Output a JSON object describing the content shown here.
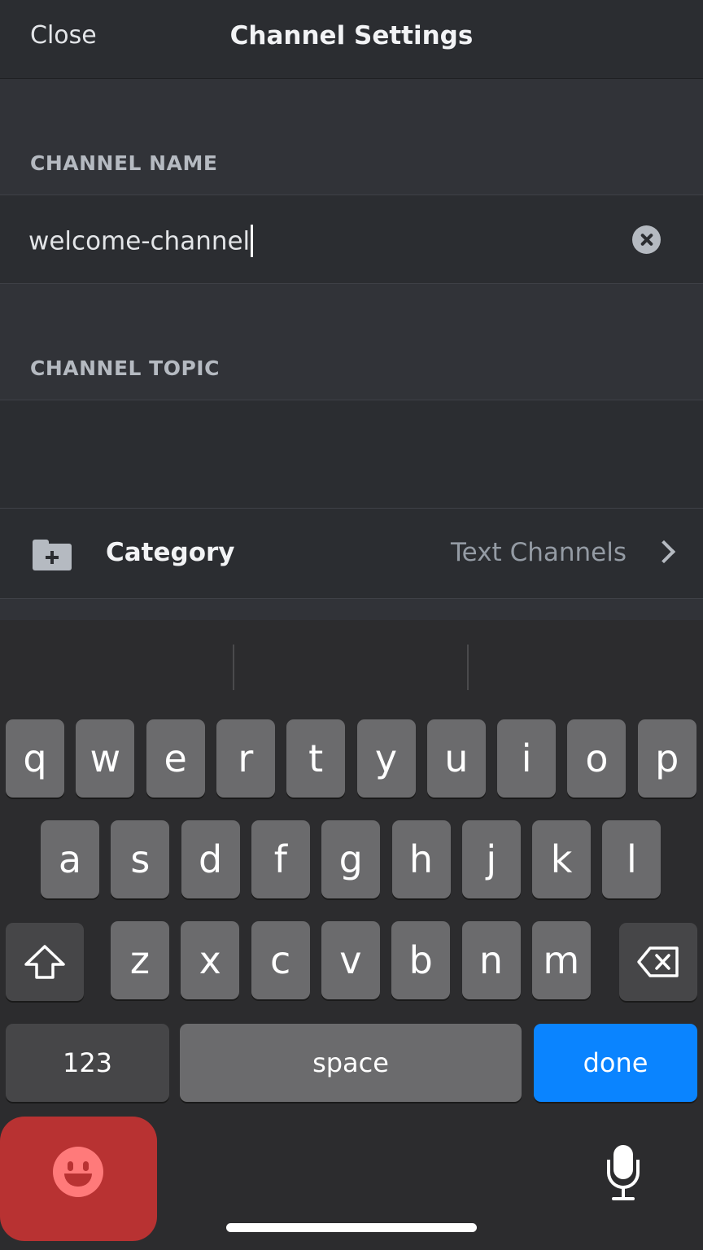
{
  "header": {
    "close_label": "Close",
    "title": "Channel Settings"
  },
  "form": {
    "name_label": "CHANNEL NAME",
    "name_value": "welcome-channel",
    "topic_label": "CHANNEL TOPIC",
    "topic_value": "",
    "category_label": "Category",
    "category_value": "Text Channels"
  },
  "keyboard": {
    "row1": [
      "q",
      "w",
      "e",
      "r",
      "t",
      "y",
      "u",
      "i",
      "o",
      "p"
    ],
    "row2": [
      "a",
      "s",
      "d",
      "f",
      "g",
      "h",
      "j",
      "k",
      "l"
    ],
    "row3": [
      "z",
      "x",
      "c",
      "v",
      "b",
      "n",
      "m"
    ],
    "numbers_label": "123",
    "space_label": "space",
    "done_label": "done"
  },
  "icons": {
    "clear": "clear-circle-x-icon",
    "category": "folder-plus-icon",
    "chevron": "chevron-right-icon",
    "shift": "shift-arrow-icon",
    "backspace": "backspace-icon",
    "emoji": "emoji-face-icon",
    "mic": "microphone-icon"
  },
  "colors": {
    "accent": "#0a84ff",
    "emoji_bg": "#b83232",
    "background": "#313338"
  }
}
